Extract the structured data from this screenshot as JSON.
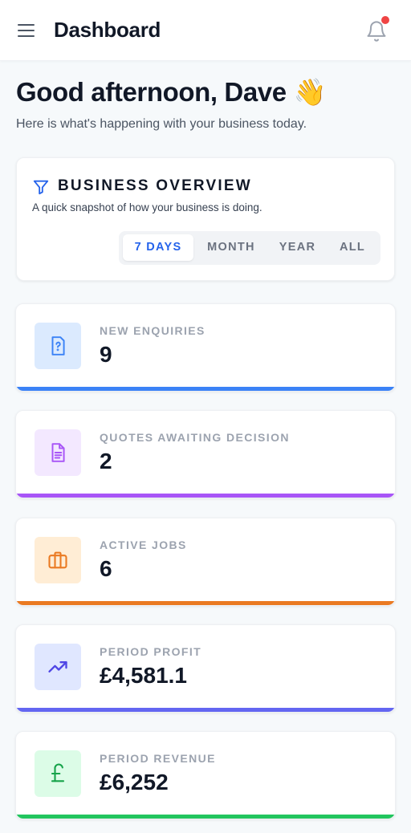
{
  "header": {
    "title": "Dashboard",
    "menu_icon": "menu-icon",
    "bell_icon": "bell-icon",
    "notification_dot_color": "#ef4444"
  },
  "greeting": {
    "title": "Good afternoon, Dave 👋",
    "subtitle": "Here is what's happening with your business today."
  },
  "overview": {
    "icon": "filter-icon",
    "title": "BUSINESS OVERVIEW",
    "subtitle": "A quick snapshot of how your business is doing.",
    "periods": [
      "7 DAYS",
      "MONTH",
      "YEAR",
      "ALL"
    ],
    "selected_period": "7 DAYS",
    "accent": "#2563eb"
  },
  "stats": [
    {
      "label": "NEW ENQUIRIES",
      "value": "9",
      "icon": "question-document-icon",
      "color": "#3b82f6",
      "icon_bg": "#dbeafe"
    },
    {
      "label": "QUOTES AWAITING DECISION",
      "value": "2",
      "icon": "document-icon",
      "color": "#a855f7",
      "icon_bg": "#f3e8ff"
    },
    {
      "label": "ACTIVE JOBS",
      "value": "6",
      "icon": "briefcase-icon",
      "color": "#ea7a22",
      "icon_bg": "#ffedd5"
    },
    {
      "label": "PERIOD PROFIT",
      "value": "£4,581.1",
      "icon": "trending-up-icon",
      "color": "#6366f1",
      "icon_bg": "#e0e7ff"
    },
    {
      "label": "PERIOD REVENUE",
      "value": "£6,252",
      "icon": "pound-icon",
      "color": "#22c55e",
      "icon_bg": "#dcfce7"
    }
  ]
}
